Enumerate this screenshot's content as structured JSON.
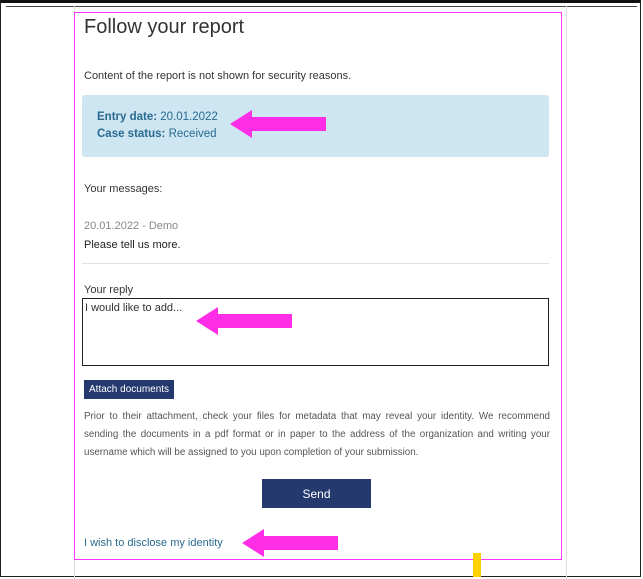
{
  "page": {
    "title": "Follow your report",
    "subtitle": "Content of the report is not shown for security reasons."
  },
  "status": {
    "entry_date_label": "Entry date:",
    "entry_date_value": "20.01.2022",
    "case_status_label": "Case status:",
    "case_status_value": "Received"
  },
  "messages": {
    "label": "Your messages:",
    "items": [
      {
        "meta": "20.01.2022 - Demo",
        "text": "Please tell us more."
      }
    ]
  },
  "reply": {
    "label": "Your reply",
    "value": "I would like to add..."
  },
  "attachments": {
    "button_label": "Attach documents",
    "notice": "Prior to their attachment, check your files for metadata that may reveal your identity. We recommend sending the documents in a pdf format or in paper to the address of the organization and writing your username which will be assigned to you upon completion of your submission."
  },
  "actions": {
    "send_label": "Send",
    "disclose_identity_link": "I wish to disclose my identity"
  },
  "annotations": {
    "arrow_color": "#ff2ee6",
    "frame_color": "#ff33ff",
    "marker_color": "#ffd100"
  },
  "colors": {
    "info_box_bg": "#cde6f2",
    "info_text": "#2a6a8f",
    "button_bg": "#24396e"
  }
}
